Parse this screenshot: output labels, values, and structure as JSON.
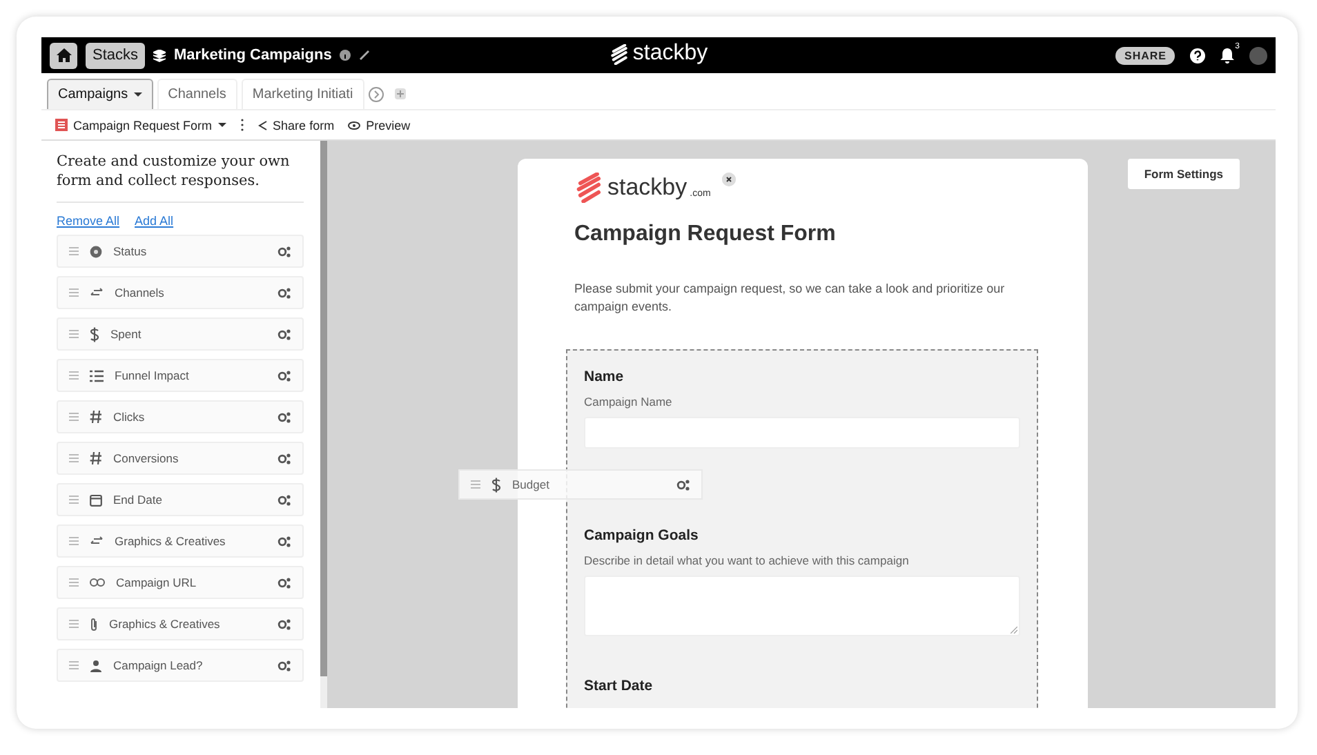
{
  "top_bar": {
    "stacks_label": "Stacks",
    "stack_name": "Marketing Campaigns",
    "logo_text": "stackby",
    "share_label": "SHARE",
    "notification_count": "3"
  },
  "tabs": [
    {
      "label": "Campaigns",
      "selected": true
    },
    {
      "label": "Channels",
      "selected": false
    },
    {
      "label": "Marketing Initiati",
      "selected": false
    }
  ],
  "toolbar": {
    "view_name": "Campaign Request Form",
    "share_label": "Share form",
    "preview_label": "Preview"
  },
  "sidebar": {
    "intro": "Create and customize your own form and collect responses.",
    "remove_all": "Remove All",
    "add_all": "Add All",
    "fields": [
      {
        "label": "Status",
        "kind": "status"
      },
      {
        "label": "Channels",
        "kind": "link"
      },
      {
        "label": "Spent",
        "kind": "currency"
      },
      {
        "label": "Funnel Impact",
        "kind": "list"
      },
      {
        "label": "Clicks",
        "kind": "number"
      },
      {
        "label": "Conversions",
        "kind": "number"
      },
      {
        "label": "End Date",
        "kind": "date"
      },
      {
        "label": "Graphics & Creatives",
        "kind": "link"
      },
      {
        "label": "Campaign URL",
        "kind": "url"
      },
      {
        "label": "Graphics & Creatives",
        "kind": "attachment"
      },
      {
        "label": "Campaign Lead?",
        "kind": "user"
      }
    ]
  },
  "dragged_field": {
    "label": "Budget",
    "kind": "currency"
  },
  "form_settings_label": "Form Settings",
  "form": {
    "logo_text": "stackby",
    "logo_suffix": ".com",
    "title": "Campaign Request Form",
    "description": "Please submit your campaign request, so we can take a look and prioritize our campaign events.",
    "fields": [
      {
        "label": "Name",
        "description": "Campaign Name",
        "kind": "text"
      },
      {
        "label": "Campaign Goals",
        "description": "Describe in detail what you want to achieve with this campaign",
        "kind": "long_text"
      },
      {
        "label": "Start Date",
        "kind": "heading_only"
      }
    ]
  }
}
